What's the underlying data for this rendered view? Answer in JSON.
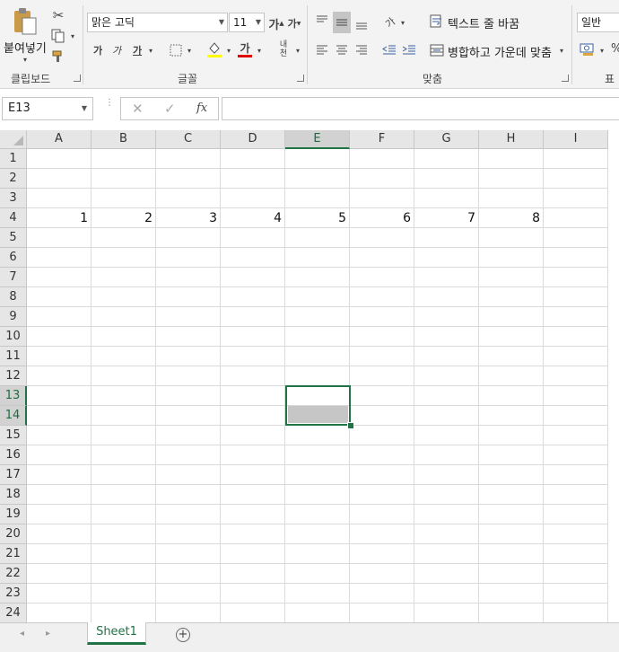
{
  "ribbon": {
    "clipboard": {
      "paste_label": "붙여넣기",
      "group_label": "클립보드"
    },
    "font": {
      "font_name": "맑은 고딕",
      "font_size": "11",
      "grow_label": "가",
      "shrink_label": "가",
      "bold_label": "가",
      "italic_label": "가",
      "underline_label": "가",
      "font_color_label": "가",
      "phonetic_label": "내천",
      "group_label": "글꼴",
      "highlight_color": "#ffff00",
      "font_color": "#e00000"
    },
    "alignment": {
      "wrap_text_label": "텍스트 줄 바꿈",
      "merge_center_label": "병합하고 가운데 맞춤",
      "orientation_label": "가",
      "group_label": "맞춤"
    },
    "number": {
      "format_value": "일반",
      "percent_label": "%",
      "group_label": "표시"
    }
  },
  "formula_bar": {
    "name_box": "E13",
    "fx_label": "fx",
    "formula": ""
  },
  "grid": {
    "columns": [
      "A",
      "B",
      "C",
      "D",
      "E",
      "F",
      "G",
      "H",
      "I"
    ],
    "selected_column": "E",
    "rows": [
      "1",
      "2",
      "3",
      "4",
      "5",
      "6",
      "7",
      "8",
      "9",
      "10",
      "11",
      "12",
      "13",
      "14",
      "15",
      "16",
      "17",
      "18",
      "19",
      "20",
      "21",
      "22",
      "23",
      "24"
    ],
    "selected_rows": [
      "13",
      "14"
    ],
    "cells": [
      {
        "col": "A",
        "row": "4",
        "value": "1"
      },
      {
        "col": "B",
        "row": "4",
        "value": "2"
      },
      {
        "col": "C",
        "row": "4",
        "value": "3"
      },
      {
        "col": "D",
        "row": "4",
        "value": "4"
      },
      {
        "col": "E",
        "row": "4",
        "value": "5"
      },
      {
        "col": "F",
        "row": "4",
        "value": "6"
      },
      {
        "col": "G",
        "row": "4",
        "value": "7"
      },
      {
        "col": "H",
        "row": "4",
        "value": "8"
      }
    ]
  },
  "sheet_tabs": {
    "tabs": [
      "Sheet1"
    ],
    "active": "Sheet1",
    "add_label": "+"
  },
  "colors": {
    "accent": "#217346",
    "selection_fill": "#c6c6c6"
  }
}
